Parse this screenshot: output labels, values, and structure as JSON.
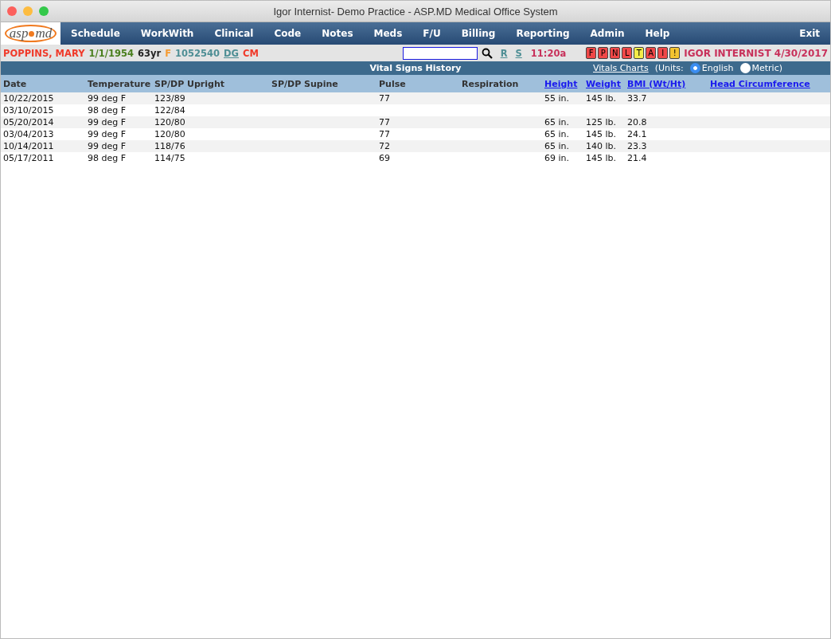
{
  "window": {
    "title": "Igor Internist- Demo Practice - ASP.MD Medical Office System"
  },
  "logo": {
    "left": "asp",
    "right": "md"
  },
  "menu": [
    {
      "label": "Schedule"
    },
    {
      "label": "WorkWith"
    },
    {
      "label": "Clinical"
    },
    {
      "label": "Code"
    },
    {
      "label": "Notes"
    },
    {
      "label": "Meds"
    },
    {
      "label": "F/U"
    },
    {
      "label": "Billing"
    },
    {
      "label": "Reporting"
    },
    {
      "label": "Admin"
    },
    {
      "label": "Help"
    }
  ],
  "exit": "Exit",
  "patient": {
    "name": "POPPINS, MARY",
    "dob": "1/1/1954",
    "age": "63yr",
    "sex": "F",
    "id": "1052540",
    "links": [
      "DG"
    ],
    "code": "CM"
  },
  "quick_links": [
    "R",
    "S"
  ],
  "time": "11:20a",
  "flags": [
    {
      "label": "F",
      "color": "#f04848"
    },
    {
      "label": "P",
      "color": "#f04848"
    },
    {
      "label": "N",
      "color": "#f04848"
    },
    {
      "label": "L",
      "color": "#f04848"
    },
    {
      "label": "T",
      "color": "#f4ec4a"
    },
    {
      "label": "A",
      "color": "#f04848"
    },
    {
      "label": "I",
      "color": "#f04848"
    },
    {
      "label": "!",
      "color": "#f4c430"
    }
  ],
  "provider": "IGOR INTERNIST 4/30/2017",
  "section": {
    "title": "Vital Signs History",
    "charts_link": "Vitals Charts",
    "units_label": "(Units:",
    "units": [
      {
        "label": "English",
        "selected": true
      },
      {
        "label": "Metric)",
        "selected": false
      }
    ]
  },
  "table": {
    "columns": [
      {
        "label": "Date",
        "kind": "plain"
      },
      {
        "label": "Temperature",
        "kind": "plain"
      },
      {
        "label": "SP/DP Upright",
        "kind": "plain"
      },
      {
        "label": "SP/DP Supine",
        "kind": "plain"
      },
      {
        "label": "Pulse",
        "kind": "plain"
      },
      {
        "label": "Respiration",
        "kind": "plain"
      },
      {
        "label": "Height",
        "kind": "link"
      },
      {
        "label": "Weight",
        "kind": "link"
      },
      {
        "label": "BMI (Wt/Ht)",
        "kind": "link"
      },
      {
        "label": "Head Circumference",
        "kind": "link"
      }
    ],
    "rows": [
      [
        "10/22/2015",
        "99 deg F",
        "123/89",
        "",
        "77",
        "",
        "55 in.",
        "145 lb.",
        "33.7",
        ""
      ],
      [
        "03/10/2015",
        "98 deg F",
        "122/84",
        "",
        "",
        "",
        "",
        "",
        "",
        ""
      ],
      [
        "05/20/2014",
        "99 deg F",
        "120/80",
        "",
        "77",
        "",
        "65 in.",
        "125 lb.",
        "20.8",
        ""
      ],
      [
        "03/04/2013",
        "99 deg F",
        "120/80",
        "",
        "77",
        "",
        "65 in.",
        "145 lb.",
        "24.1",
        ""
      ],
      [
        "10/14/2011",
        "99 deg F",
        "118/76",
        "",
        "72",
        "",
        "65 in.",
        "140 lb.",
        "23.3",
        ""
      ],
      [
        "05/17/2011",
        "98 deg F",
        "114/75",
        "",
        "69",
        "",
        "69 in.",
        "145 lb.",
        "21.4",
        ""
      ]
    ]
  }
}
